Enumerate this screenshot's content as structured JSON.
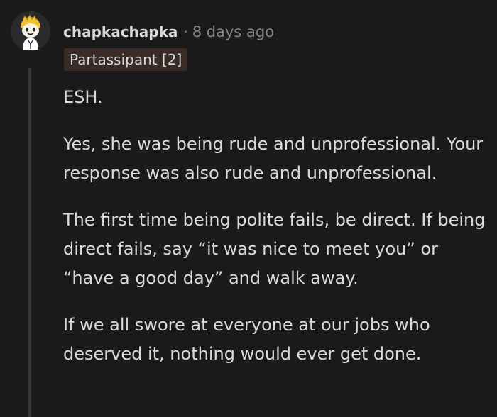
{
  "comment": {
    "author": "chapkachapka",
    "separator": "·",
    "timestamp": "8 days ago",
    "flair": "Partassipant [2]",
    "paragraphs": [
      "ESH.",
      "Yes, she was being rude and unprofessional. Your response was also rude and unprofessional.",
      "The first time being polite fails, be direct. If being direct fails, say “it was nice to meet you” or “have a good day” and walk away.",
      "If we all swore at everyone at our jobs who deserved it, nothing would ever get done."
    ]
  },
  "colors": {
    "background": "#1a1a1b",
    "text": "#d7dadc",
    "meta": "#818384",
    "flair_bg": "#3a2b26",
    "thread_line": "#343536"
  },
  "icons": {
    "avatar": "snoo-avatar-icon"
  }
}
